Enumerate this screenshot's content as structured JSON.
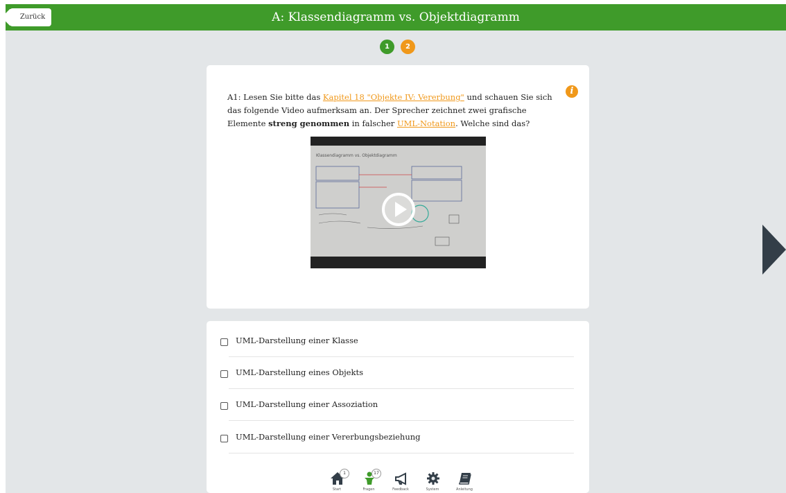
{
  "header": {
    "back_label": "Zurück",
    "title": "A: Klassendiagramm vs. Objektdiagramm"
  },
  "steps": [
    "1",
    "2"
  ],
  "question": {
    "prefix": "A1: Lesen Sie bitte das ",
    "link1": "Kapitel 18 \"Objekte IV: Vererbung\"",
    "mid1": " und schauen Sie sich das folgende Video aufmerksam an. Der Sprecher zeichnet zwei grafische Elemente ",
    "bold": "streng genommen",
    "mid2": " in falscher ",
    "link2": "UML-Notation",
    "suffix": ". Welche sind das?",
    "info_icon": "i"
  },
  "video": {
    "frame_title": "Klassendiagramm vs. Objektdiagramm"
  },
  "options": [
    "UML-Darstellung einer Klasse",
    "UML-Darstellung eines Objekts",
    "UML-Darstellung einer Assoziation",
    "UML-Darstellung einer Vererbungsbeziehung"
  ],
  "nav": {
    "start": {
      "label": "Start",
      "badge": "1"
    },
    "fragen": {
      "label": "Fragen",
      "badge": "17"
    },
    "feedback": {
      "label": "Feedback"
    },
    "system": {
      "label": "System"
    },
    "anleitung": {
      "label": "Anleitung"
    }
  },
  "colors": {
    "green": "#3f9b2a",
    "orange": "#f0981a",
    "dark": "#333e48"
  }
}
